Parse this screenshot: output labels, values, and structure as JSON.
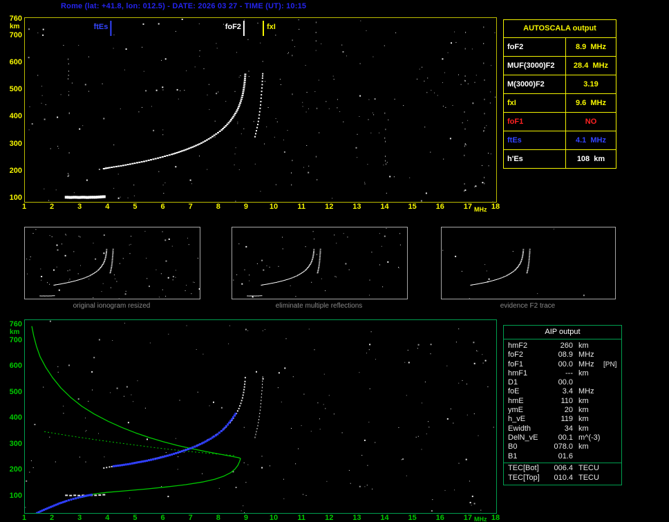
{
  "header": {
    "title": "Rome (lat: +41.8, lon: 012.5) - DATE: 2026 03 27 - TIME (UT): 10:15",
    "color": "#2424ee"
  },
  "colors": {
    "background": "#000000",
    "yellow": "#f5f500",
    "green": "#00c800",
    "green_border": "#00a050",
    "blue": "#3344ff",
    "red": "#ff2222",
    "white": "#ffffff",
    "gray_caption": "#8a8a8a",
    "noise_bright": "#e8e8e8",
    "noise_dim": "#9a9a9a"
  },
  "main_plot": {
    "y_unit": "km",
    "x_unit": "MHz",
    "y_ticks": [
      "760",
      "700",
      "600",
      "500",
      "400",
      "300",
      "200",
      "100"
    ],
    "x_ticks": [
      "1",
      "2",
      "3",
      "4",
      "5",
      "6",
      "7",
      "8",
      "9",
      "10",
      "11",
      "12",
      "13",
      "14",
      "15",
      "16",
      "17",
      "18"
    ],
    "markers": [
      {
        "label": "ftEs",
        "freq": 4.1,
        "color": "#3344ff",
        "side": "left"
      },
      {
        "label": "foF2",
        "freq": 8.9,
        "color": "#ffffff",
        "side": "left"
      },
      {
        "label": "fxI",
        "freq": 9.6,
        "color": "#f5f500",
        "side": "right"
      }
    ]
  },
  "bottom_plot": {
    "y_unit": "km",
    "x_unit": "MHz",
    "y_ticks": [
      "760",
      "700",
      "600",
      "500",
      "400",
      "300",
      "200",
      "100"
    ],
    "x_ticks": [
      "1",
      "2",
      "3",
      "4",
      "5",
      "6",
      "7",
      "8",
      "9",
      "10",
      "11",
      "12",
      "13",
      "14",
      "15",
      "16",
      "17",
      "18"
    ]
  },
  "autoscala_table": {
    "title": "AUTOSCALA output",
    "rows": [
      {
        "label": "foF2",
        "value": "8.9",
        "unit": "MHz",
        "label_color": "#ffffff",
        "value_color": "#f5f500"
      },
      {
        "label": "MUF(3000)F2",
        "value": "28.4",
        "unit": "MHz",
        "label_color": "#ffffff",
        "value_color": "#f5f500"
      },
      {
        "label": "M(3000)F2",
        "value": "3.19",
        "unit": "",
        "label_color": "#ffffff",
        "value_color": "#f5f500"
      },
      {
        "label": "fxI",
        "value": "9.6",
        "unit": "MHz",
        "label_color": "#f5f500",
        "value_color": "#f5f500"
      },
      {
        "label": "foF1",
        "value": "NO",
        "unit": "",
        "label_color": "#ff2222",
        "value_color": "#ff2222"
      },
      {
        "label": "ftEs",
        "value": "4.1",
        "unit": "MHz",
        "label_color": "#3344ff",
        "value_color": "#3344ff"
      },
      {
        "label": "h'Es",
        "value": "108",
        "unit": "km",
        "label_color": "#ffffff",
        "value_color": "#ffffff"
      }
    ]
  },
  "thumbnails": [
    {
      "caption": "original ionogram resized"
    },
    {
      "caption": "eliminate multiple reflections"
    },
    {
      "caption": "evidence F2 trace"
    }
  ],
  "aip_table": {
    "title": "AIP output",
    "rows": [
      {
        "label": "hmF2",
        "value": "260",
        "unit": "km",
        "note": ""
      },
      {
        "label": "foF2",
        "value": "08.9",
        "unit": "MHz",
        "note": ""
      },
      {
        "label": "foF1",
        "value": "00.0",
        "unit": "MHz",
        "note": "[PN]"
      },
      {
        "label": "hmF1",
        "value": "---",
        "unit": "km",
        "note": ""
      },
      {
        "label": "D1",
        "value": "00.0",
        "unit": "",
        "note": ""
      },
      {
        "label": "foE",
        "value": "3.4",
        "unit": "MHz",
        "note": ""
      },
      {
        "label": "hmE",
        "value": "110",
        "unit": "km",
        "note": ""
      },
      {
        "label": "ymE",
        "value": "20",
        "unit": "km",
        "note": ""
      },
      {
        "label": "h_vE",
        "value": "119",
        "unit": "km",
        "note": ""
      },
      {
        "label": "Ewidth",
        "value": "34",
        "unit": "km",
        "note": ""
      },
      {
        "label": "DelN_vE",
        "value": "00.1",
        "unit": "m^(-3)",
        "note": ""
      },
      {
        "label": "B0",
        "value": "078.0",
        "unit": "km",
        "note": ""
      },
      {
        "label": "B1",
        "value": "01.6",
        "unit": "",
        "note": ""
      },
      {
        "label": "TEC[Bot]",
        "value": "006.4",
        "unit": "TECU",
        "note": "",
        "divider_before": true
      },
      {
        "label": "TEC[Top]",
        "value": "010.4",
        "unit": "TECU",
        "note": ""
      }
    ]
  },
  "chart_data": [
    {
      "type": "scatter",
      "title": "Ionogram - virtual height vs frequency",
      "xlabel": "MHz",
      "ylabel": "km",
      "xlim": [
        1,
        18
      ],
      "ylim": [
        80,
        780
      ],
      "grid": false,
      "annotations": [
        {
          "label": "ftEs",
          "x": 4.1
        },
        {
          "label": "foF2",
          "x": 8.9
        },
        {
          "label": "fxI",
          "x": 9.6
        }
      ],
      "series": [
        {
          "name": "F2 ordinary trace",
          "mode": "dots",
          "color": "#ffffff",
          "dot": [
            3,
            2
          ],
          "step": 3,
          "points": [
            [
              3.85,
              212
            ],
            [
              4.05,
              216
            ],
            [
              4.3,
              220
            ],
            [
              4.55,
              224
            ],
            [
              4.8,
              229
            ],
            [
              5.05,
              234
            ],
            [
              5.3,
              239
            ],
            [
              5.55,
              245
            ],
            [
              5.8,
              251
            ],
            [
              6.05,
              258
            ],
            [
              6.3,
              265
            ],
            [
              6.55,
              273
            ],
            [
              6.8,
              282
            ],
            [
              7.05,
              292
            ],
            [
              7.3,
              303
            ],
            [
              7.5,
              314
            ],
            [
              7.7,
              326
            ],
            [
              7.9,
              340
            ],
            [
              8.1,
              355
            ],
            [
              8.25,
              370
            ],
            [
              8.4,
              387
            ],
            [
              8.52,
              404
            ],
            [
              8.63,
              422
            ],
            [
              8.72,
              441
            ],
            [
              8.79,
              461
            ],
            [
              8.85,
              482
            ],
            [
              8.89,
              503
            ],
            [
              8.92,
              524
            ],
            [
              8.94,
              545
            ],
            [
              8.95,
              560
            ]
          ]
        },
        {
          "name": "F2 extraordinary trace",
          "mode": "dots",
          "color": "#ffffff",
          "dot": [
            2,
            2
          ],
          "step": 4,
          "points": [
            [
              9.3,
              330
            ],
            [
              9.35,
              352
            ],
            [
              9.4,
              375
            ],
            [
              9.44,
              398
            ],
            [
              9.47,
              422
            ],
            [
              9.5,
              447
            ],
            [
              9.52,
              472
            ],
            [
              9.54,
              497
            ],
            [
              9.56,
              522
            ],
            [
              9.57,
              546
            ],
            [
              9.58,
              562
            ]
          ]
        },
        {
          "name": "Es trace",
          "mode": "dots",
          "color": "#ffffff",
          "dot": [
            5,
            4
          ],
          "step": 4,
          "points": [
            [
              2.5,
              107
            ],
            [
              2.65,
              106
            ],
            [
              2.8,
              107
            ],
            [
              2.95,
              106
            ],
            [
              3.1,
              107
            ],
            [
              3.25,
              106
            ],
            [
              3.4,
              107
            ],
            [
              3.55,
              107
            ],
            [
              3.7,
              108
            ],
            [
              3.85,
              109
            ]
          ]
        }
      ]
    },
    {
      "type": "line",
      "title": "AIP restored trace and electron density profile",
      "xlabel": "MHz",
      "ylabel": "km",
      "xlim": [
        1,
        18
      ],
      "ylim": [
        80,
        780
      ],
      "grid": false,
      "series": [
        {
          "name": "restored F2 trace",
          "mode": "dots",
          "color": "#2e3eff",
          "dot": [
            3,
            3
          ],
          "step": 3,
          "points": [
            [
              4.2,
              219
            ],
            [
              4.5,
              223
            ],
            [
              4.8,
              228
            ],
            [
              5.1,
              234
            ],
            [
              5.4,
              240
            ],
            [
              5.7,
              247
            ],
            [
              6.0,
              255
            ],
            [
              6.3,
              264
            ],
            [
              6.6,
              274
            ],
            [
              6.9,
              285
            ],
            [
              7.2,
              297
            ],
            [
              7.45,
              310
            ],
            [
              7.7,
              325
            ],
            [
              7.95,
              342
            ],
            [
              8.15,
              360
            ],
            [
              8.32,
              380
            ],
            [
              8.47,
              400
            ],
            [
              8.6,
              421
            ]
          ]
        },
        {
          "name": "restored E trace",
          "mode": "dots",
          "color": "#2e3eff",
          "dot": [
            3,
            3
          ],
          "step": 3,
          "points": [
            [
              1.25,
              28
            ],
            [
              1.5,
              42
            ],
            [
              1.75,
              54
            ],
            [
              2.0,
              65
            ],
            [
              2.25,
              76
            ],
            [
              2.5,
              85
            ],
            [
              2.75,
              93
            ],
            [
              3.0,
              100
            ],
            [
              3.2,
              105
            ],
            [
              3.4,
              109
            ]
          ]
        },
        {
          "name": "electron density profile topside",
          "mode": "line",
          "color": "#00c800",
          "width": 1.3,
          "points": [
            [
              1.25,
              758
            ],
            [
              1.32,
              720
            ],
            [
              1.42,
              680
            ],
            [
              1.55,
              640
            ],
            [
              1.75,
              600
            ],
            [
              2.0,
              560
            ],
            [
              2.3,
              520
            ],
            [
              2.65,
              484
            ],
            [
              3.05,
              450
            ],
            [
              3.5,
              420
            ],
            [
              4.0,
              392
            ],
            [
              4.5,
              368
            ],
            [
              5.0,
              347
            ],
            [
              5.5,
              329
            ],
            [
              6.0,
              313
            ],
            [
              6.5,
              299
            ],
            [
              7.0,
              287
            ],
            [
              7.5,
              276
            ],
            [
              8.0,
              266
            ],
            [
              8.4,
              258
            ],
            [
              8.7,
              252
            ],
            [
              8.78,
              249
            ]
          ]
        },
        {
          "name": "electron density profile bottomside",
          "mode": "line",
          "color": "#00c800",
          "width": 1.3,
          "points": [
            [
              8.78,
              249
            ],
            [
              8.74,
              236
            ],
            [
              8.68,
              222
            ],
            [
              8.58,
              208
            ],
            [
              8.42,
              194
            ],
            [
              8.18,
              181
            ],
            [
              7.85,
              169
            ],
            [
              7.4,
              158
            ],
            [
              6.8,
              148
            ],
            [
              6.1,
              139
            ],
            [
              5.35,
              131
            ],
            [
              4.6,
              124
            ],
            [
              3.95,
              118
            ],
            [
              3.55,
              113
            ],
            [
              3.4,
              110
            ],
            [
              3.3,
              105
            ],
            [
              3.1,
              100
            ],
            [
              2.85,
              96
            ]
          ]
        },
        {
          "name": "model profile dotted",
          "mode": "line",
          "color": "#00c800",
          "width": 1,
          "dash": "2 3",
          "points": [
            [
              1.7,
              352
            ],
            [
              2.6,
              336
            ],
            [
              3.6,
              320
            ],
            [
              4.7,
              304
            ],
            [
              5.8,
              289
            ],
            [
              6.9,
              276
            ],
            [
              7.9,
              266
            ],
            [
              8.55,
              260
            ]
          ]
        }
      ]
    }
  ]
}
